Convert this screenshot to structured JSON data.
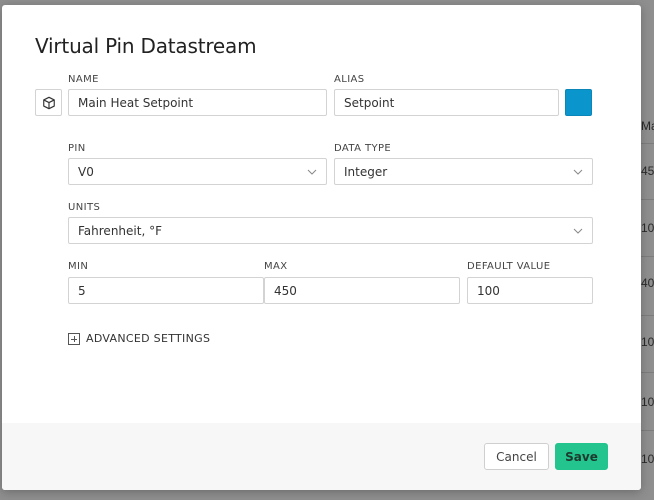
{
  "background": {
    "right_header": "Ma",
    "right_values": [
      "45",
      "10",
      "40",
      "10",
      "10",
      "10"
    ]
  },
  "modal": {
    "title": "Virtual Pin Datastream",
    "icon": "cube-icon",
    "name": {
      "label": "NAME",
      "value": "Main Heat Setpoint"
    },
    "alias": {
      "label": "ALIAS",
      "value": "Setpoint"
    },
    "color": "#0a96cc",
    "pin": {
      "label": "PIN",
      "value": "V0"
    },
    "data_type": {
      "label": "DATA TYPE",
      "value": "Integer"
    },
    "units": {
      "label": "UNITS",
      "value": "Fahrenheit, °F"
    },
    "min": {
      "label": "MIN",
      "value": "5"
    },
    "max": {
      "label": "MAX",
      "value": "450"
    },
    "default_value": {
      "label": "DEFAULT VALUE",
      "value": "100"
    },
    "advanced_label": "ADVANCED SETTINGS"
  },
  "footer": {
    "cancel_label": "Cancel",
    "save_label": "Save",
    "save_color": "#23c48e"
  }
}
